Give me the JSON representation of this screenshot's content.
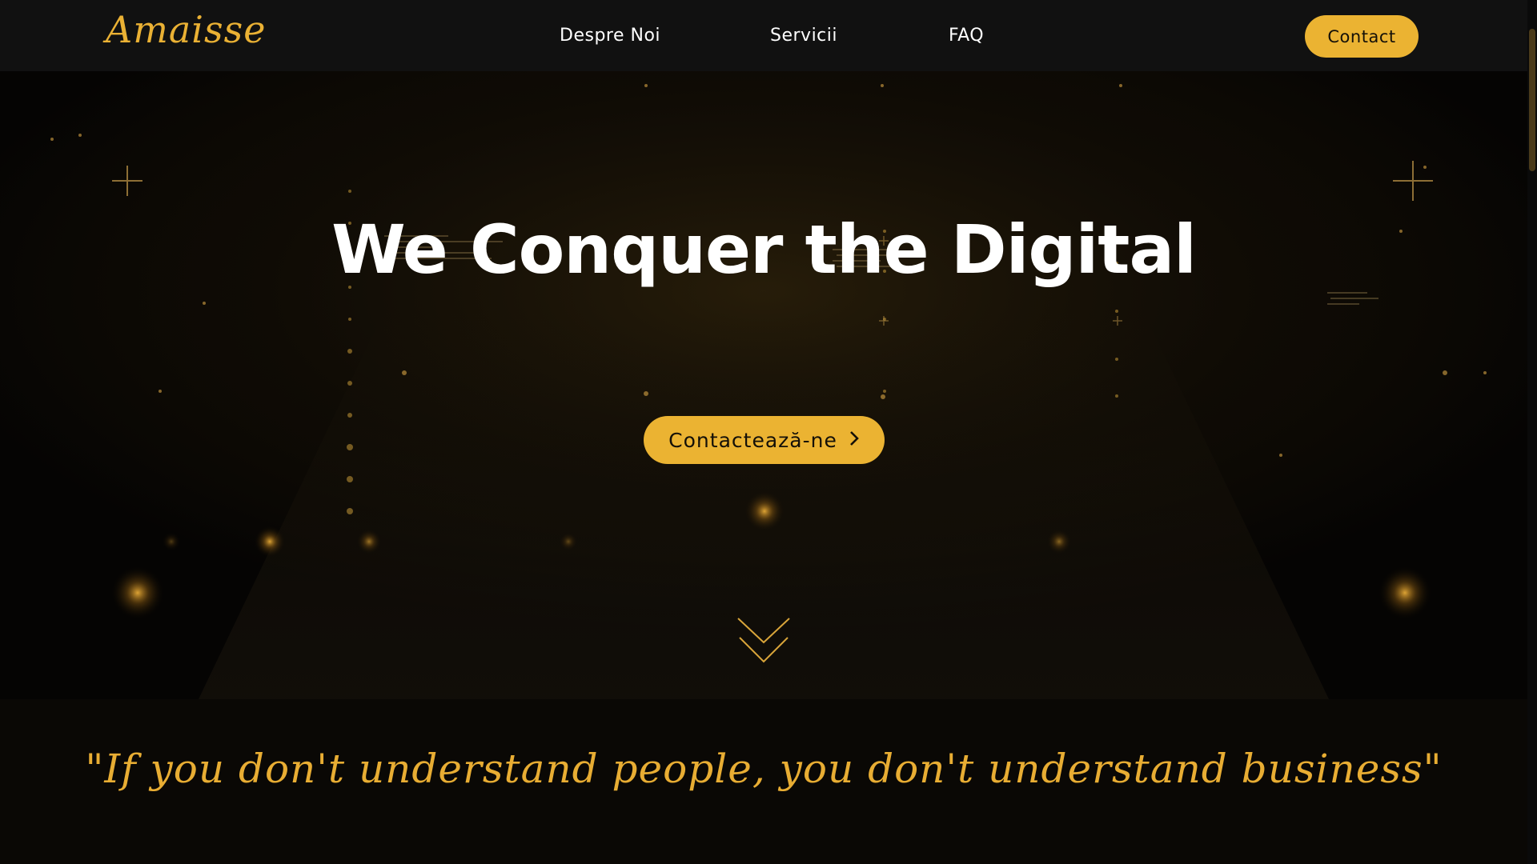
{
  "header": {
    "logo_text": "Amaisse",
    "nav": [
      {
        "label": "Despre Noi"
      },
      {
        "label": "Servicii"
      },
      {
        "label": "FAQ"
      }
    ],
    "contact_label": "Contact"
  },
  "hero": {
    "title": "We Conquer the Digital",
    "cta_label": "Contactează-ne",
    "cta_icon": "chevron-right-icon",
    "scroll_icon": "double-chevron-down-icon"
  },
  "quote": {
    "text": "\"If you don't understand people, you don't understand business\""
  },
  "colors": {
    "accent": "#ebb332",
    "header_bg": "#111111",
    "page_bg": "#0a0805",
    "text": "#ffffff"
  }
}
